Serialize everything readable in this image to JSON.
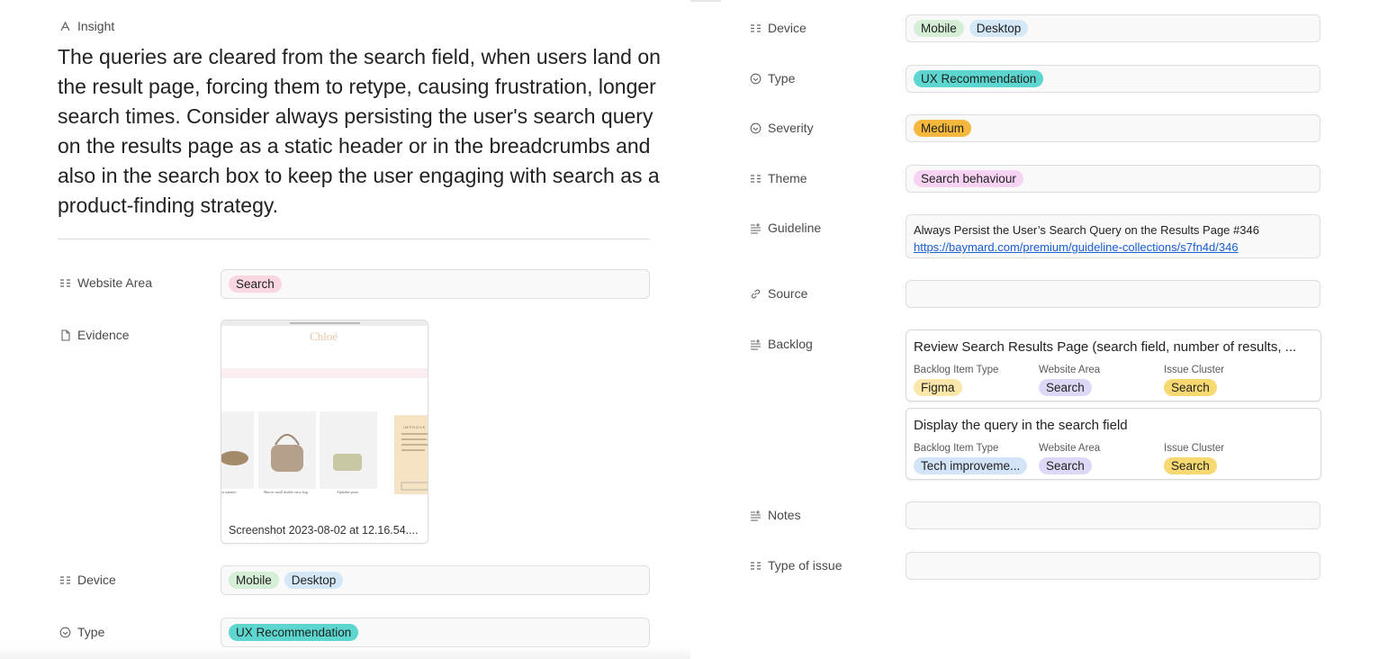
{
  "insight": {
    "label": "Insight",
    "text": "The queries are cleared from the search field, when users land on the result page, forcing them to retype, causing frustration, longer search times. Consider always persisting the user's search query on the results page as a static header or in the breadcrumbs and also in the search box to keep the user engaging with search as a product-finding strategy."
  },
  "left_fields": {
    "website_area": {
      "label": "Website Area",
      "tags": [
        "Search"
      ]
    },
    "evidence": {
      "label": "Evidence",
      "file_name": "Screenshot 2023-08-02 at 12.16.54....",
      "thumb_brand": "Chloé",
      "thumb_caption_1": "Marcie small double carry bag",
      "thumb_caption_2": "Alphabet purse",
      "thumb_caption_3": "ra sneaker",
      "thumb_promo": "IMPROVE"
    },
    "device": {
      "label": "Device",
      "tags": [
        "Mobile",
        "Desktop"
      ]
    },
    "type": {
      "label": "Type",
      "tags": [
        "UX Recommendation"
      ]
    }
  },
  "right_fields": {
    "device": {
      "label": "Device",
      "tags": [
        "Mobile",
        "Desktop"
      ]
    },
    "type": {
      "label": "Type",
      "tags": [
        "UX Recommendation"
      ]
    },
    "severity": {
      "label": "Severity",
      "tags": [
        "Medium"
      ]
    },
    "theme": {
      "label": "Theme",
      "tags": [
        "Search behaviour"
      ]
    },
    "guideline": {
      "label": "Guideline",
      "text": "Always Persist the User’s Search Query on the Results Page #346",
      "link": "https://baymard.com/premium/guideline-collections/s7fn4d/346"
    },
    "source": {
      "label": "Source"
    },
    "backlog": {
      "label": "Backlog",
      "items": [
        {
          "title": "Review Search Results Page (search field, number of results, ...",
          "col1_label": "Backlog Item Type",
          "col1_tag": "Figma",
          "col2_label": "Website Area",
          "col2_tag": "Search",
          "col3_label": "Issue Cluster",
          "col3_tag": "Search"
        },
        {
          "title": "Display the query in the search field",
          "col1_label": "Backlog Item Type",
          "col1_tag": "Tech improveme...",
          "col2_label": "Website Area",
          "col2_tag": "Search",
          "col3_label": "Issue Cluster",
          "col3_tag": "Search"
        }
      ]
    },
    "notes": {
      "label": "Notes"
    },
    "type_of_issue": {
      "label": "Type of issue"
    }
  },
  "colors": {
    "tag_search_pink": "#f9d6e0",
    "tag_mobile_green": "#d4efd6",
    "tag_desktop_blue": "#d4e8f8",
    "tag_ux_teal": "#5dd6cf",
    "tag_medium_orange": "#f5b83d",
    "tag_theme_pink": "#f6d3f3",
    "tag_figma_yellow": "#fbe7a9",
    "tag_area_purple": "#ddd8f6",
    "tag_cluster_yellow": "#f7d871",
    "tag_tech_blue": "#d4e4f8",
    "link_blue": "#1a5fd1"
  }
}
